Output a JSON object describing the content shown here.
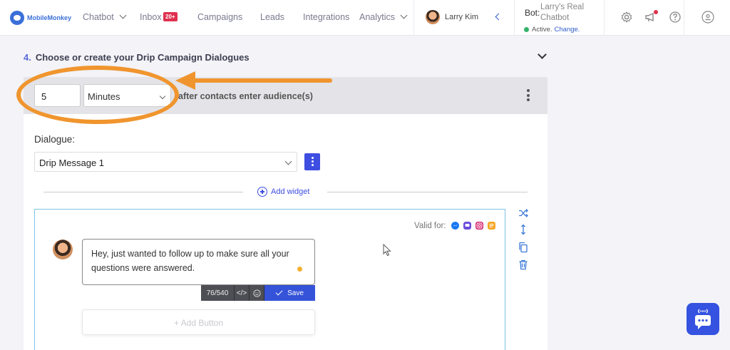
{
  "nav": {
    "logo": "MobileMonkey",
    "chatbot": "Chatbot",
    "inbox": "Inbox",
    "inbox_badge": "20+",
    "campaigns": "Campaigns",
    "leads": "Leads",
    "integrations": "Integrations",
    "analytics": "Analytics",
    "user_name": "Larry Kim",
    "bot_label": "Bot:",
    "bot_name": "Larry's Real Chatbot",
    "bot_status": "Active.",
    "bot_change": "Change."
  },
  "section": {
    "number": "4.",
    "title": "Choose or create your Drip Campaign Dialogues"
  },
  "step": {
    "delay_value": "5",
    "delay_unit": "Minutes",
    "after_text": "after contacts enter audience(s)",
    "dialogue_label": "Dialogue:",
    "dialogue_value": "Drip Message 1",
    "add_widget": "Add widget"
  },
  "widget": {
    "valid_for": "Valid for:",
    "message": "Hey, just wanted to follow up to make sure all your questions were answered.",
    "char_count": "76/540",
    "code_label": "</>",
    "save": "Save",
    "add_button": "+ Add Button"
  },
  "colors": {
    "accent": "#3d4ee0",
    "annotation": "#f0952e",
    "messenger": "#1877f2",
    "instagram": "#d6246e",
    "sms": "#f5a623"
  },
  "icons": [
    "chevron-down-icon",
    "settings-icon",
    "megaphone-icon",
    "help-icon",
    "account-icon",
    "shuffle-icon",
    "resize-vertical-icon",
    "copy-icon",
    "trash-icon",
    "emoji-icon",
    "chat-bot-icon"
  ]
}
